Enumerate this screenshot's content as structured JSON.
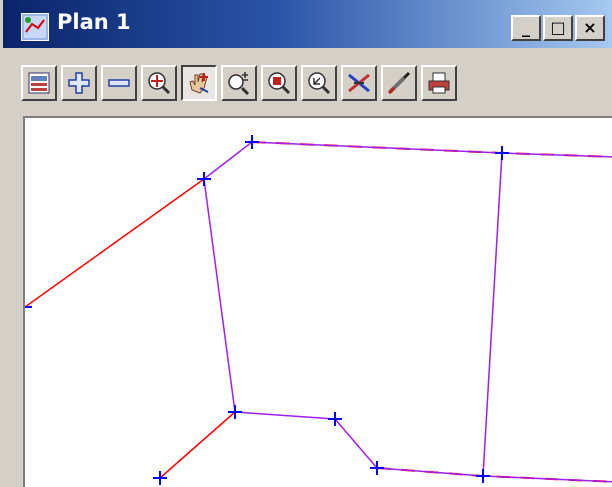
{
  "window": {
    "title": "Plan 1"
  },
  "title_buttons": {
    "minimize": "_",
    "maximize": "□",
    "close": "×"
  },
  "toolbar": {
    "buttons": [
      {
        "icon": "plan-view-icon",
        "pressed": false
      },
      {
        "icon": "zoom-in-plus-icon",
        "pressed": false
      },
      {
        "icon": "zoom-out-minus-icon",
        "pressed": false
      },
      {
        "icon": "fit-view-icon",
        "pressed": false
      },
      {
        "icon": "pan-hand-icon",
        "pressed": true
      },
      {
        "icon": "zoom-plus-minus-icon",
        "pressed": false
      },
      {
        "icon": "zoom-window-icon",
        "pressed": false
      },
      {
        "icon": "zoom-previous-icon",
        "pressed": false
      },
      {
        "icon": "intersect-icon",
        "pressed": false
      },
      {
        "icon": "pick-icon",
        "pressed": false
      },
      {
        "icon": "print-icon",
        "pressed": false
      }
    ]
  },
  "colors": {
    "red_line": "#ff0000",
    "purple_line": "#a020f0",
    "vertex": "#0000ff"
  }
}
